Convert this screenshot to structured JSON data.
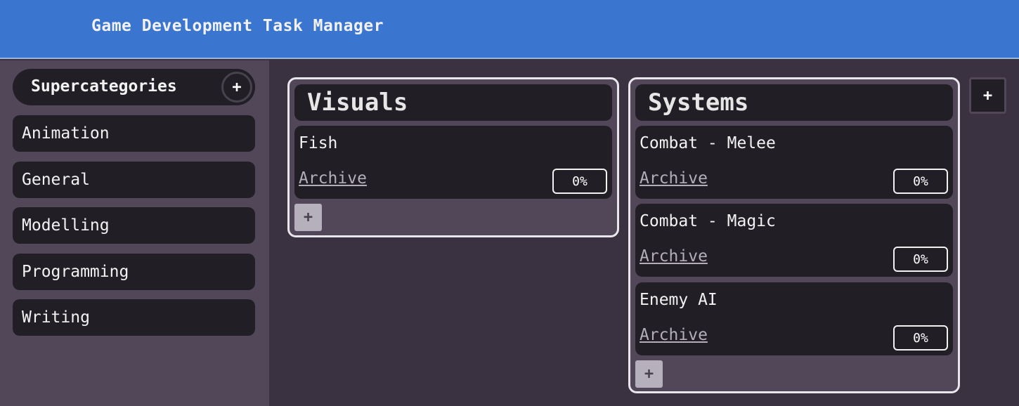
{
  "header": {
    "title": "Game Development Task Manager"
  },
  "sidebar": {
    "title": "Supercategories",
    "add_label": "+",
    "items": [
      "Animation",
      "General",
      "Modelling",
      "Programming",
      "Writing"
    ]
  },
  "columns": [
    {
      "title": "Visuals",
      "add_label": "+",
      "tasks": [
        {
          "title": "Fish",
          "archive": "Archive",
          "progress": "0%"
        }
      ]
    },
    {
      "title": "Systems",
      "add_label": "+",
      "tasks": [
        {
          "title": "Combat - Melee",
          "archive": "Archive",
          "progress": "0%"
        },
        {
          "title": "Combat - Magic",
          "archive": "Archive",
          "progress": "0%"
        },
        {
          "title": "Enemy AI",
          "archive": "Archive",
          "progress": "0%"
        }
      ]
    }
  ],
  "board": {
    "add_column_label": "+"
  },
  "colors": {
    "header": "#3a76cf",
    "sidebar": "#514759",
    "board": "#3a3241",
    "card": "#211f25"
  }
}
